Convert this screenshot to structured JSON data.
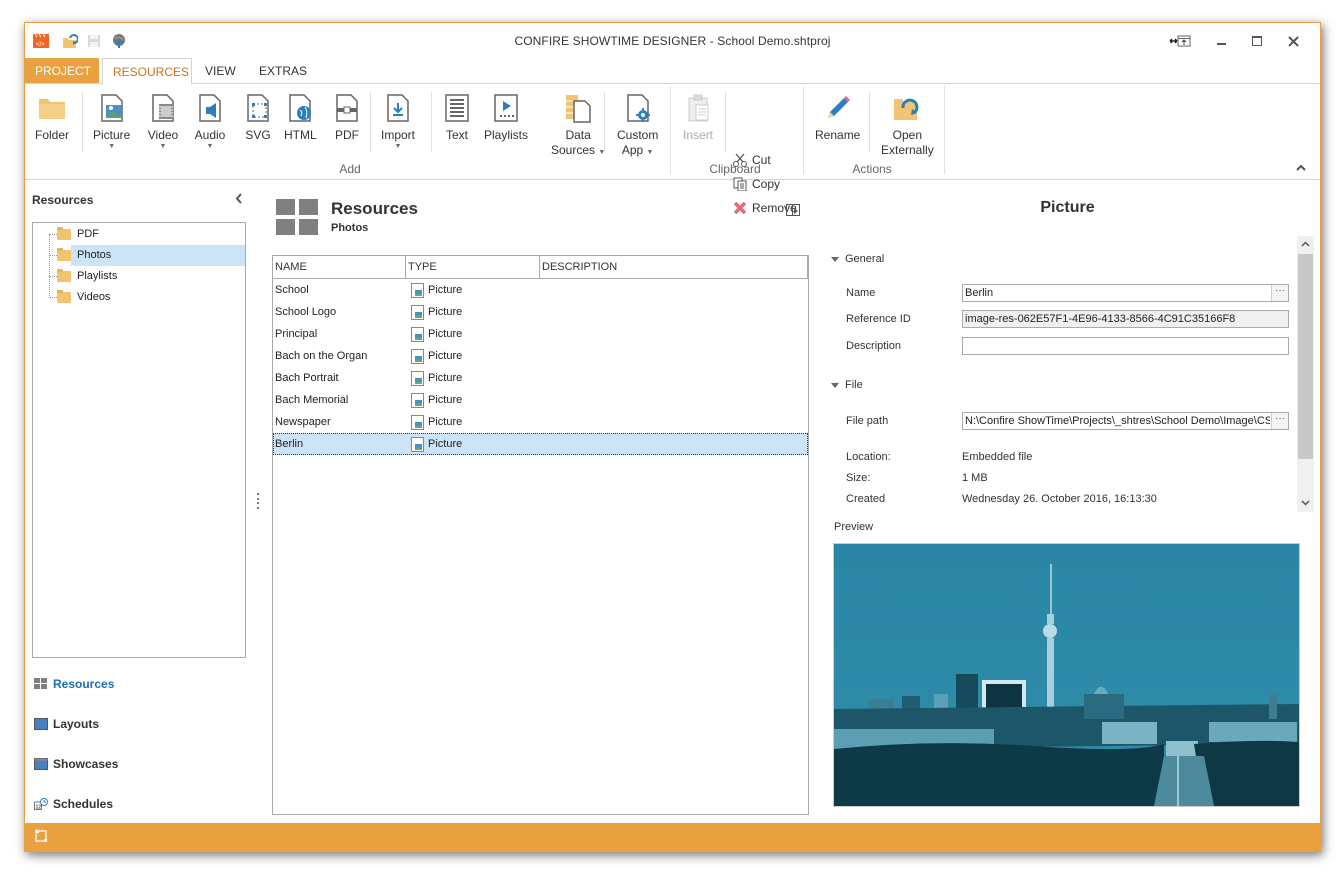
{
  "window": {
    "title": "CONFIRE SHOWTIME DESIGNER - School Demo.shtproj",
    "accent": "#e9a23f"
  },
  "quick_access": [
    "app-logo-icon",
    "open-project-icon",
    "save-icon",
    "publish-icon"
  ],
  "tabs": [
    {
      "label": "PROJECT",
      "active": false
    },
    {
      "label": "RESOURCES",
      "active": true
    },
    {
      "label": "VIEW",
      "active": false
    },
    {
      "label": "EXTRAS",
      "active": false
    }
  ],
  "ribbon": {
    "folder": "Folder",
    "picture": "Picture",
    "video": "Video",
    "audio": "Audio",
    "svg": "SVG",
    "html": "HTML",
    "pdf": "PDF",
    "import": "Import",
    "text": "Text",
    "playlists": "Playlists",
    "data_sources_1": "Data",
    "data_sources_2": "Sources",
    "custom_app_1": "Custom",
    "custom_app_2": "App",
    "insert": "Insert",
    "cut": "Cut",
    "copy": "Copy",
    "remove": "Remove",
    "rename": "Rename",
    "open_ext_1": "Open",
    "open_ext_2": "Externally",
    "groups": {
      "add": "Add",
      "clipboard": "Clipboard",
      "actions": "Actions"
    }
  },
  "left": {
    "title": "Resources",
    "tree": [
      "PDF",
      "Photos",
      "Playlists",
      "Videos"
    ],
    "selected": "Photos",
    "nav": [
      "Resources",
      "Layouts",
      "Showcases",
      "Schedules"
    ],
    "nav_active": "Resources"
  },
  "center": {
    "title": "Resources",
    "subtitle": "Photos",
    "columns": [
      "NAME",
      "TYPE",
      "DESCRIPTION"
    ],
    "rows": [
      {
        "name": "School",
        "type": "Picture",
        "description": ""
      },
      {
        "name": "School Logo",
        "type": "Picture",
        "description": ""
      },
      {
        "name": "Principal",
        "type": "Picture",
        "description": ""
      },
      {
        "name": "Bach on the Organ",
        "type": "Picture",
        "description": ""
      },
      {
        "name": "Bach Portrait",
        "type": "Picture",
        "description": ""
      },
      {
        "name": "Bach Memorial",
        "type": "Picture",
        "description": ""
      },
      {
        "name": "Newspaper",
        "type": "Picture",
        "description": ""
      },
      {
        "name": "Berlin",
        "type": "Picture",
        "description": ""
      }
    ],
    "selected_row": "Berlin"
  },
  "properties": {
    "title": "Picture",
    "general_label": "General",
    "name_label": "Name",
    "name_value": "Berlin",
    "refid_label": "Reference ID",
    "refid_value": "image-res-062E57F1-4E96-4133-8566-4C91C35166F8",
    "desc_label": "Description",
    "desc_value": "",
    "file_label": "File",
    "filepath_label": "File path",
    "filepath_value": "N:\\Confire ShowTime\\Projects\\_shtres\\School Demo\\Image\\CST",
    "location_label": "Location:",
    "location_value": "Embedded file",
    "size_label": "Size:",
    "size_value": "1 MB",
    "created_label": "Created",
    "created_value": "Wednesday 26. October 2016, 16:13:30",
    "ellipsis": "···",
    "preview_label": "Preview"
  }
}
